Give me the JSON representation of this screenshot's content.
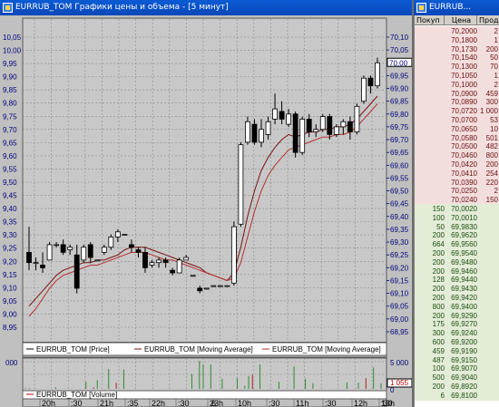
{
  "chart_window": {
    "title": "EURRUB_TOM Графики цены и объема - [5 минут]"
  },
  "quote_window": {
    "title": "EURRUB...",
    "columns": [
      "Покуп",
      "Цена",
      "Продаж"
    ]
  },
  "quotes": {
    "sell": [
      {
        "buy": "",
        "price": "70,2000",
        "sell": "2"
      },
      {
        "buy": "",
        "price": "70,1800",
        "sell": "1"
      },
      {
        "buy": "",
        "price": "70,1730",
        "sell": "200"
      },
      {
        "buy": "",
        "price": "70,1540",
        "sell": "50"
      },
      {
        "buy": "",
        "price": "70,1300",
        "sell": "70"
      },
      {
        "buy": "",
        "price": "70,1050",
        "sell": "1"
      },
      {
        "buy": "",
        "price": "70,1000",
        "sell": "2"
      },
      {
        "buy": "",
        "price": "70,0900",
        "sell": "459"
      },
      {
        "buy": "",
        "price": "70,0890",
        "sell": "300"
      },
      {
        "buy": "",
        "price": "70,0720",
        "sell": "1 000"
      },
      {
        "buy": "",
        "price": "70,0700",
        "sell": "53"
      },
      {
        "buy": "",
        "price": "70,0650",
        "sell": "10"
      },
      {
        "buy": "",
        "price": "70,0580",
        "sell": "501"
      },
      {
        "buy": "",
        "price": "70,0500",
        "sell": "482"
      },
      {
        "buy": "",
        "price": "70,0460",
        "sell": "800"
      },
      {
        "buy": "",
        "price": "70,0420",
        "sell": "200"
      },
      {
        "buy": "",
        "price": "70,0410",
        "sell": "254"
      },
      {
        "buy": "",
        "price": "70,0390",
        "sell": "220"
      },
      {
        "buy": "",
        "price": "70,0250",
        "sell": "2"
      },
      {
        "buy": "",
        "price": "70,0240",
        "sell": "150"
      }
    ],
    "buy": [
      {
        "buy": "150",
        "price": "70,0020",
        "sell": ""
      },
      {
        "buy": "100",
        "price": "70,0010",
        "sell": ""
      },
      {
        "buy": "50",
        "price": "69,9830",
        "sell": ""
      },
      {
        "buy": "200",
        "price": "69,9620",
        "sell": ""
      },
      {
        "buy": "664",
        "price": "69,9560",
        "sell": ""
      },
      {
        "buy": "200",
        "price": "69,9540",
        "sell": ""
      },
      {
        "buy": "200",
        "price": "69,9480",
        "sell": ""
      },
      {
        "buy": "200",
        "price": "69,9460",
        "sell": ""
      },
      {
        "buy": "128",
        "price": "69,9440",
        "sell": ""
      },
      {
        "buy": "200",
        "price": "69,9430",
        "sell": ""
      },
      {
        "buy": "200",
        "price": "69,9420",
        "sell": ""
      },
      {
        "buy": "800",
        "price": "69,9400",
        "sell": ""
      },
      {
        "buy": "200",
        "price": "69,9290",
        "sell": ""
      },
      {
        "buy": "175",
        "price": "69,9270",
        "sell": ""
      },
      {
        "buy": "300",
        "price": "69,9240",
        "sell": ""
      },
      {
        "buy": "600",
        "price": "69,9200",
        "sell": ""
      },
      {
        "buy": "459",
        "price": "69,9190",
        "sell": ""
      },
      {
        "buy": "487",
        "price": "69,9150",
        "sell": ""
      },
      {
        "buy": "100",
        "price": "69,9070",
        "sell": ""
      },
      {
        "buy": "500",
        "price": "69,9040",
        "sell": ""
      },
      {
        "buy": "200",
        "price": "69,8920",
        "sell": ""
      },
      {
        "buy": "6",
        "price": "69,8100",
        "sell": ""
      }
    ]
  },
  "chart_data": [
    {
      "type": "candlestick",
      "left_ticks": [
        "10,05",
        "10,00",
        "9,95",
        "9,90",
        "9,85",
        "9,80",
        "9,75",
        "9,70",
        "9,65",
        "9,60",
        "9,55",
        "9,50",
        "9,45",
        "9,40",
        "9,35",
        "9,30",
        "9,25",
        "9,20",
        "9,15",
        "9,10",
        "9,05",
        "9,00",
        "8,95"
      ],
      "right_ticks": [
        "70,10",
        "70,05",
        "70,00",
        "69,95",
        "69,90",
        "69,85",
        "69,80",
        "69,75",
        "69,70",
        "69,65",
        "69,60",
        "69,55",
        "69,50",
        "69,45",
        "69,40",
        "69,35",
        "69,30",
        "69,25",
        "69,20",
        "69,15",
        "69,10",
        "69,05",
        "69,00",
        "68,95"
      ],
      "left_range": [
        8.95,
        10.05
      ],
      "right_range": [
        68.95,
        70.1
      ],
      "last_price_label": "70,00",
      "legend": [
        "EURRUB_TOM [Price]",
        "EURRUB_TOM [Moving Average]",
        "EURRUB_TOM [Moving Average]"
      ],
      "candles": [
        [
          69.26,
          69.36,
          69.19,
          69.22
        ],
        [
          69.22,
          69.24,
          69.19,
          69.22
        ],
        [
          69.21,
          69.26,
          69.18,
          69.2
        ],
        [
          69.23,
          69.3,
          69.23,
          69.29
        ],
        [
          69.29,
          69.3,
          69.28,
          69.29
        ],
        [
          69.29,
          69.31,
          69.25,
          69.26
        ],
        [
          69.27,
          69.29,
          69.25,
          69.28
        ],
        [
          69.25,
          69.29,
          69.1,
          69.12
        ],
        [
          69.23,
          69.29,
          69.22,
          69.28
        ],
        [
          69.29,
          69.3,
          69.22,
          69.24
        ],
        [
          69.23,
          69.23,
          69.23,
          69.23
        ],
        [
          69.26,
          69.29,
          69.25,
          69.28
        ],
        [
          69.28,
          69.33,
          69.27,
          69.32
        ],
        [
          69.32,
          69.35,
          69.3,
          69.34
        ],
        [
          69.33,
          69.33,
          69.33,
          69.33
        ],
        [
          69.29,
          69.31,
          69.26,
          69.28
        ],
        [
          69.27,
          69.28,
          69.24,
          69.26
        ],
        [
          69.26,
          69.28,
          69.18,
          69.2
        ],
        [
          69.21,
          69.23,
          69.2,
          69.22
        ],
        [
          69.22,
          69.24,
          69.2,
          69.23
        ],
        [
          69.23,
          69.24,
          69.2,
          69.22
        ],
        [
          69.19,
          69.2,
          69.17,
          69.18
        ],
        [
          69.18,
          69.24,
          69.18,
          69.23
        ],
        [
          69.23,
          69.25,
          69.23,
          69.24
        ],
        [
          69.17,
          69.17,
          69.17,
          69.17
        ],
        [
          69.12,
          69.13,
          69.1,
          69.11
        ],
        [
          69.12,
          69.12,
          69.12,
          69.12
        ],
        [
          69.13,
          69.13,
          69.13,
          69.13
        ],
        [
          69.13,
          69.13,
          69.13,
          69.13
        ],
        [
          69.13,
          69.13,
          69.13,
          69.13
        ],
        [
          69.14,
          69.38,
          69.13,
          69.36
        ],
        [
          69.37,
          69.69,
          69.36,
          69.68
        ],
        [
          69.69,
          69.79,
          69.68,
          69.77
        ],
        [
          69.76,
          69.78,
          69.68,
          69.69
        ],
        [
          69.69,
          69.78,
          69.67,
          69.74
        ],
        [
          69.72,
          69.79,
          69.7,
          69.77
        ],
        [
          69.78,
          69.88,
          69.76,
          69.82
        ],
        [
          69.81,
          69.85,
          69.76,
          69.78
        ],
        [
          69.76,
          69.82,
          69.75,
          69.8
        ],
        [
          69.8,
          69.81,
          69.63,
          69.65
        ],
        [
          69.65,
          69.79,
          69.64,
          69.78
        ],
        [
          69.78,
          69.8,
          69.71,
          69.73
        ],
        [
          69.73,
          69.76,
          69.71,
          69.74
        ],
        [
          69.74,
          69.8,
          69.73,
          69.79
        ],
        [
          69.79,
          69.8,
          69.7,
          69.72
        ],
        [
          69.72,
          69.76,
          69.71,
          69.75
        ],
        [
          69.75,
          69.78,
          69.72,
          69.77
        ],
        [
          69.77,
          69.79,
          69.7,
          69.73
        ],
        [
          69.73,
          69.84,
          69.72,
          69.83
        ],
        [
          69.85,
          69.95,
          69.84,
          69.94
        ],
        [
          69.94,
          69.95,
          69.88,
          69.91
        ],
        [
          69.91,
          70.02,
          69.9,
          70.0
        ]
      ],
      "moving_average_1": [
        69.05,
        69.08,
        69.11,
        69.14,
        69.17,
        69.19,
        69.2,
        69.21,
        69.22,
        69.22,
        69.23,
        69.23,
        69.24,
        69.25,
        69.27,
        69.28,
        69.28,
        69.28,
        69.27,
        69.26,
        69.25,
        69.24,
        69.23,
        69.22,
        69.21,
        69.2,
        69.18,
        69.17,
        69.16,
        69.15,
        69.18,
        69.28,
        69.4,
        69.5,
        69.58,
        69.63,
        69.67,
        69.7,
        69.72,
        69.71,
        69.72,
        69.73,
        69.73,
        69.74,
        69.74,
        69.75,
        69.75,
        69.76,
        69.78,
        69.81,
        69.84,
        69.87
      ],
      "moving_average_2": [
        69.01,
        69.04,
        69.08,
        69.12,
        69.15,
        69.17,
        69.18,
        69.19,
        69.2,
        69.21,
        69.21,
        69.22,
        69.23,
        69.24,
        69.25,
        69.26,
        69.26,
        69.26,
        69.25,
        69.24,
        69.23,
        69.23,
        69.22,
        69.21,
        69.2,
        69.19,
        69.18,
        69.17,
        69.16,
        69.15,
        69.16,
        69.22,
        69.32,
        69.42,
        69.5,
        69.56,
        69.6,
        69.63,
        69.66,
        69.67,
        69.68,
        69.69,
        69.7,
        69.71,
        69.71,
        69.72,
        69.72,
        69.73,
        69.75,
        69.78,
        69.81,
        69.84
      ]
    },
    {
      "type": "bar",
      "series_name": "EURRUB_TOM [Volume]",
      "left_tick": "000",
      "right_ticks": [
        "5 000",
        "0"
      ],
      "last_volume_label": "1 055",
      "values": [
        100,
        150,
        0,
        0,
        0,
        0,
        0,
        0,
        300,
        0,
        0,
        0,
        0,
        0,
        0,
        0,
        1400,
        0,
        300,
        1700,
        0,
        0,
        3900,
        0,
        1200,
        0,
        3800,
        0,
        0,
        0,
        0,
        0,
        0,
        0,
        0,
        0,
        0,
        0,
        0,
        0,
        0,
        0,
        0,
        0,
        2900,
        0,
        5500,
        4800,
        0,
        4800,
        0,
        0,
        2000,
        0,
        0,
        0,
        2100,
        0,
        600,
        2500,
        2800,
        0,
        4800,
        0,
        0,
        0,
        0,
        1400,
        0,
        0,
        0,
        4400,
        0,
        0,
        2000,
        0,
        1100,
        0,
        0,
        0,
        0,
        0,
        0,
        0,
        0,
        1300,
        0,
        0,
        1200,
        0,
        2100,
        0,
        4200,
        0,
        1055
      ],
      "time_labels": [
        "20h",
        ":30",
        "21h",
        ":35",
        "22h",
        ":30",
        "23h",
        "10h",
        ":30",
        "11h",
        ":30",
        "12h",
        ":30",
        "13h"
      ],
      "date_label": "6"
    }
  ]
}
